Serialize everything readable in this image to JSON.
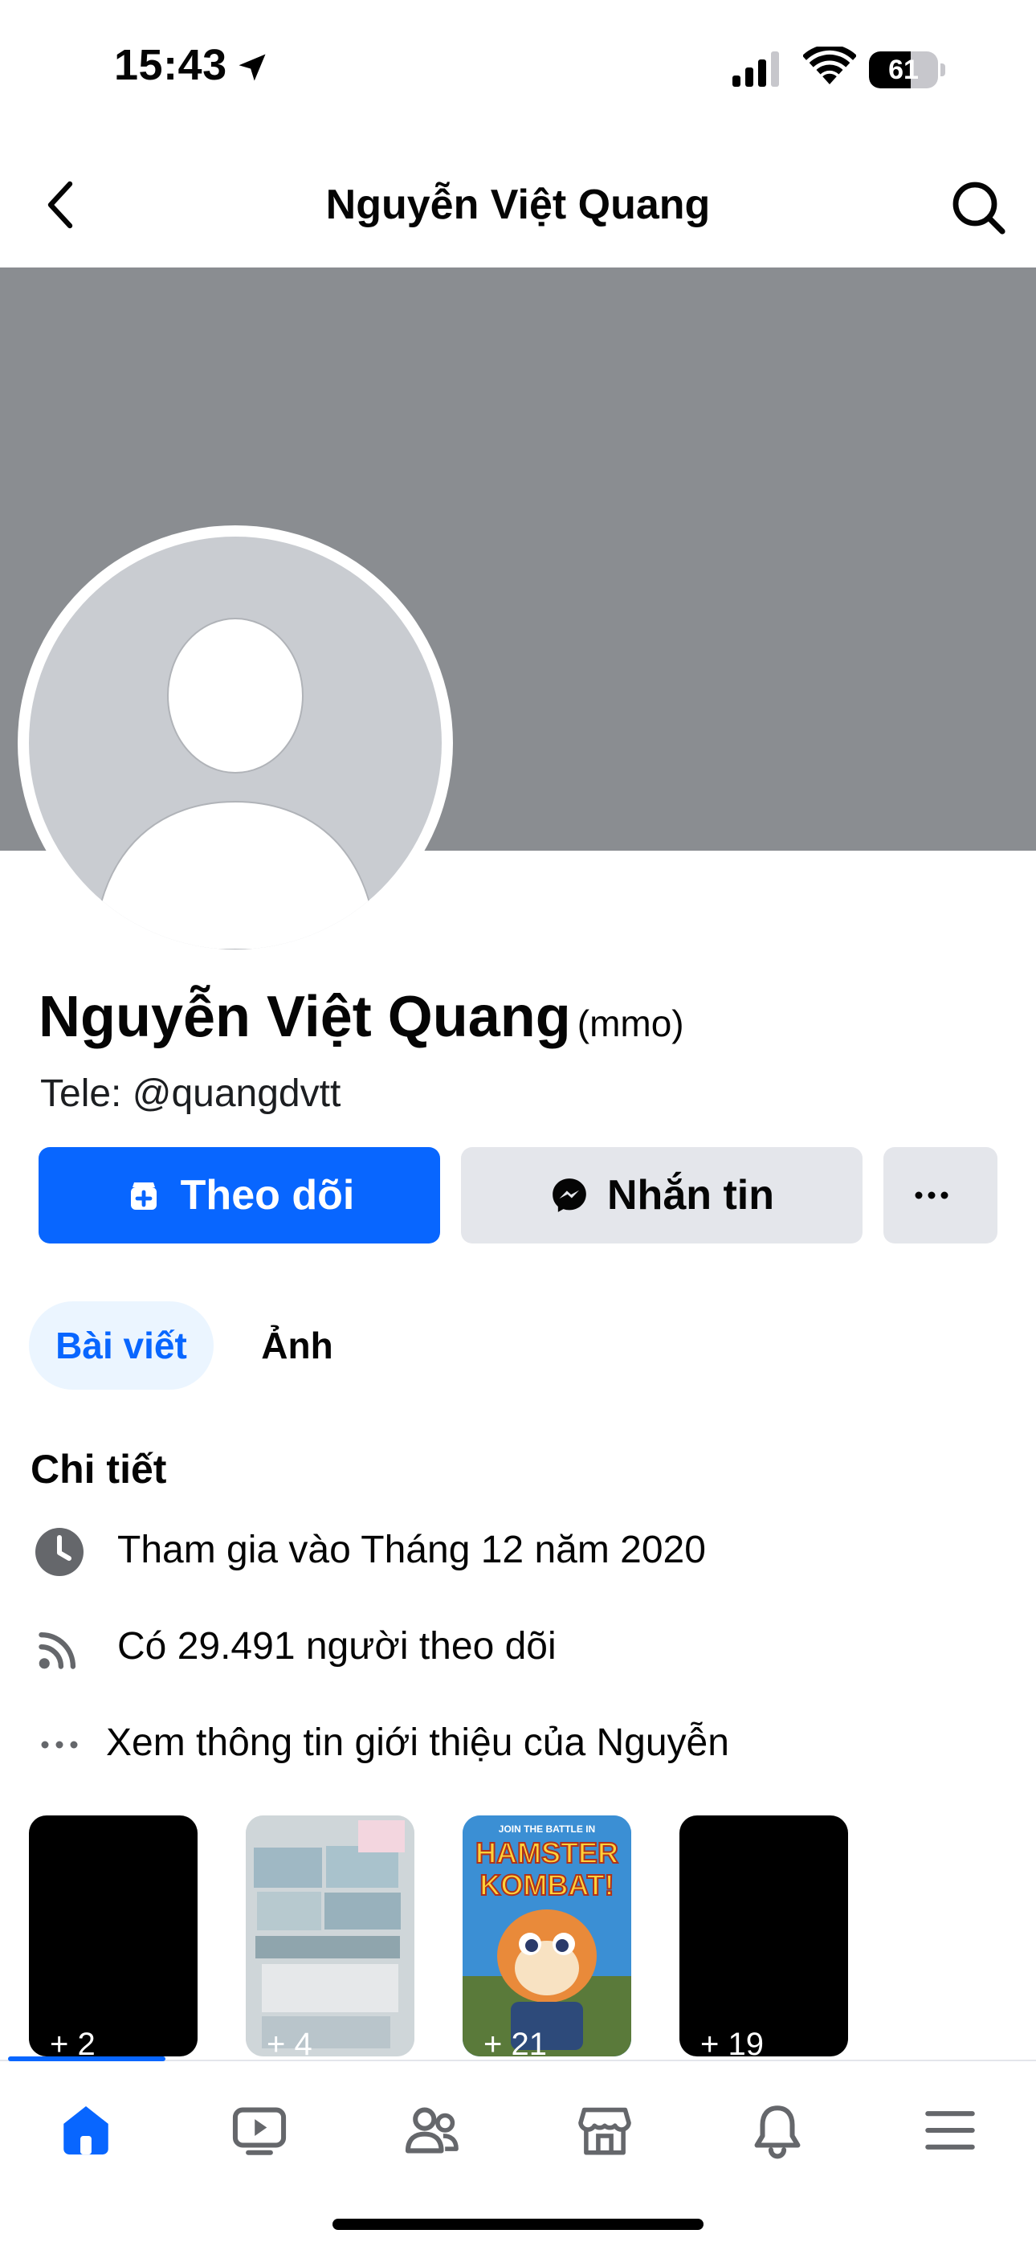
{
  "status_bar": {
    "time": "15:43",
    "battery": "61",
    "battery_level": 0.61
  },
  "header": {
    "title": "Nguyễn Việt Quang"
  },
  "profile": {
    "name": "Nguyễn Việt Quang",
    "name_suffix": "(mmo)",
    "bio": "Tele: @quangdvtt"
  },
  "actions": {
    "follow_label": "Theo dõi",
    "message_label": "Nhắn tin"
  },
  "tabs": [
    {
      "label": "Bài viết",
      "active": true
    },
    {
      "label": "Ảnh",
      "active": false
    }
  ],
  "details": {
    "title": "Chi tiết",
    "items": [
      {
        "icon": "clock-icon",
        "text": "Tham gia vào Tháng 12 năm 2020"
      },
      {
        "icon": "rss-icon",
        "text": "Có 29.491 người theo dõi"
      },
      {
        "icon": "more-dots-icon",
        "text": "Xem thông tin giới thiệu của Nguyễn"
      }
    ]
  },
  "highlights": [
    {
      "count": "+ 2"
    },
    {
      "count": "+ 4"
    },
    {
      "count": "+ 21",
      "art_text": [
        "JOIN THE BATTLE IN",
        "HAMSTER",
        "KOMBAT!"
      ]
    },
    {
      "count": "+ 19"
    }
  ],
  "bottom_nav": [
    {
      "icon": "home-icon",
      "active": true
    },
    {
      "icon": "video-icon",
      "active": false
    },
    {
      "icon": "friends-icon",
      "active": false
    },
    {
      "icon": "marketplace-icon",
      "active": false
    },
    {
      "icon": "bell-icon",
      "active": false
    },
    {
      "icon": "menu-icon",
      "active": false
    }
  ],
  "colors": {
    "accent": "#0866ff",
    "cover": "#8a8d91",
    "secondary_button": "#e4e6eb",
    "tab_active_bg": "#ebf5ff"
  }
}
